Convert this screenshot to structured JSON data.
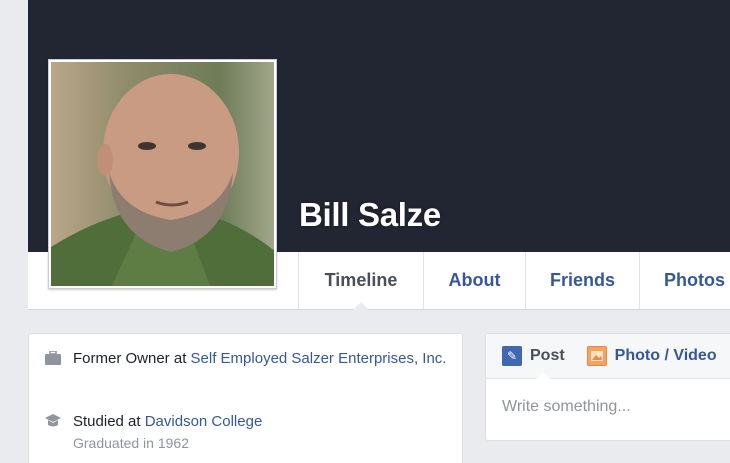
{
  "profile": {
    "name": "Bill Salze"
  },
  "tabs": [
    {
      "label": "Timeline",
      "active": true
    },
    {
      "label": "About",
      "active": false
    },
    {
      "label": "Friends",
      "active": false
    },
    {
      "label": "Photos",
      "active": false
    }
  ],
  "intro": {
    "work": {
      "prefix": "Former Owner at ",
      "link": "Self Employed Salzer Enterprises, Inc.",
      "icon": "briefcase-icon"
    },
    "education": {
      "prefix": "Studied at ",
      "link": "Davidson College",
      "sub": "Graduated in 1962",
      "icon": "graduation-cap-icon"
    }
  },
  "composer": {
    "post_label": "Post",
    "photo_label": "Photo / Video",
    "placeholder": "Write something..."
  },
  "colors": {
    "cover": "#222633",
    "link": "#365899",
    "page_bg": "#e9ebee"
  }
}
